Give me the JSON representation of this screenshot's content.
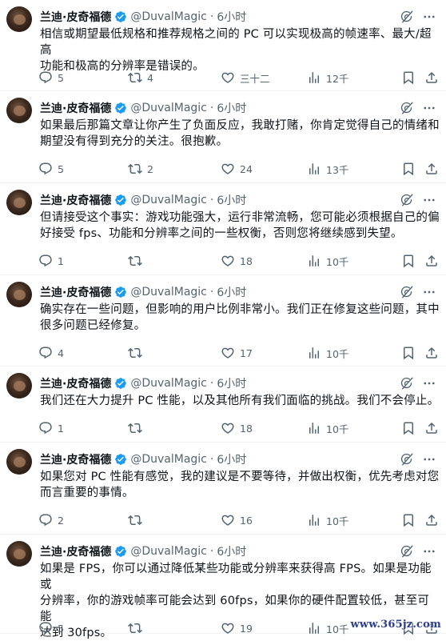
{
  "author": {
    "name": "兰迪·皮奇福德",
    "handle": "@DuvalMagic",
    "separator": "·"
  },
  "colors": {
    "verified": "#1d9bf0",
    "meta": "#536471",
    "text": "#0f1419",
    "divider": "#eff3f4"
  },
  "icons": {
    "verified": "verified-badge-icon",
    "grok": "grok-icon",
    "more": "more-icon",
    "reply": "reply-icon",
    "retweet": "retweet-icon",
    "like": "like-icon",
    "views": "views-icon",
    "bookmark": "bookmark-icon",
    "share": "share-icon"
  },
  "tweets": [
    {
      "time": "6小时",
      "lines": [
        "相信或期望最低规格和推荐规格之间的 PC 可以实现极高的帧速率、最大/超高",
        "功能和极高的分辨率是错误的。"
      ],
      "replies": "5",
      "retweets": "4",
      "likes": "三十二",
      "views": "12千"
    },
    {
      "time": "6小时",
      "lines": [
        "如果最后那篇文章让你产生了负面反应，我敢打赌，你肯定觉得自己的情绪和",
        "期望没有得到充分的关注。很抱歉。"
      ],
      "replies": "5",
      "retweets": "2",
      "likes": "24",
      "views": "13千"
    },
    {
      "time": "6小时",
      "lines": [
        "但请接受这个事实：游戏功能强大，运行非常流畅，您可能必须根据自己的偏",
        "好接受 fps、功能和分辨率之间的一些权衡，否则您将继续感到失望。"
      ],
      "replies": "1",
      "retweets": "",
      "likes": "18",
      "views": "10千"
    },
    {
      "time": "6小时",
      "lines": [
        "确实存在一些问题，但影响的用户比例非常小。我们正在修复这些问题，其中",
        "很多问题已经修复。"
      ],
      "replies": "4",
      "retweets": "",
      "likes": "17",
      "views": "10千"
    },
    {
      "time": "6小时",
      "lines": [
        "我们还在大力提升 PC 性能，以及其他所有我们面临的挑战。我们不会停止。"
      ],
      "replies": "1",
      "retweets": "",
      "likes": "18",
      "views": "10千"
    },
    {
      "time": "6小时",
      "lines": [
        "如果您对 PC 性能有感觉，我的建议是不要等待，并做出权衡，优先考虑对您",
        "而言重要的事情。"
      ],
      "replies": "2",
      "retweets": "",
      "likes": "16",
      "views": "10千"
    },
    {
      "time": "6小时",
      "lines": [
        "如果是 FPS，你可以通过降低某些功能或分辨率来获得高 FPS。如果是功能或",
        "分辨率，你的游戏帧率可能会达到 60fps，如果你的硬件配置较低，甚至可能",
        "达到 30fps。"
      ],
      "replies": "5",
      "retweets": "",
      "likes": "19",
      "views": "10千"
    }
  ],
  "watermark": "www.365jz.com"
}
